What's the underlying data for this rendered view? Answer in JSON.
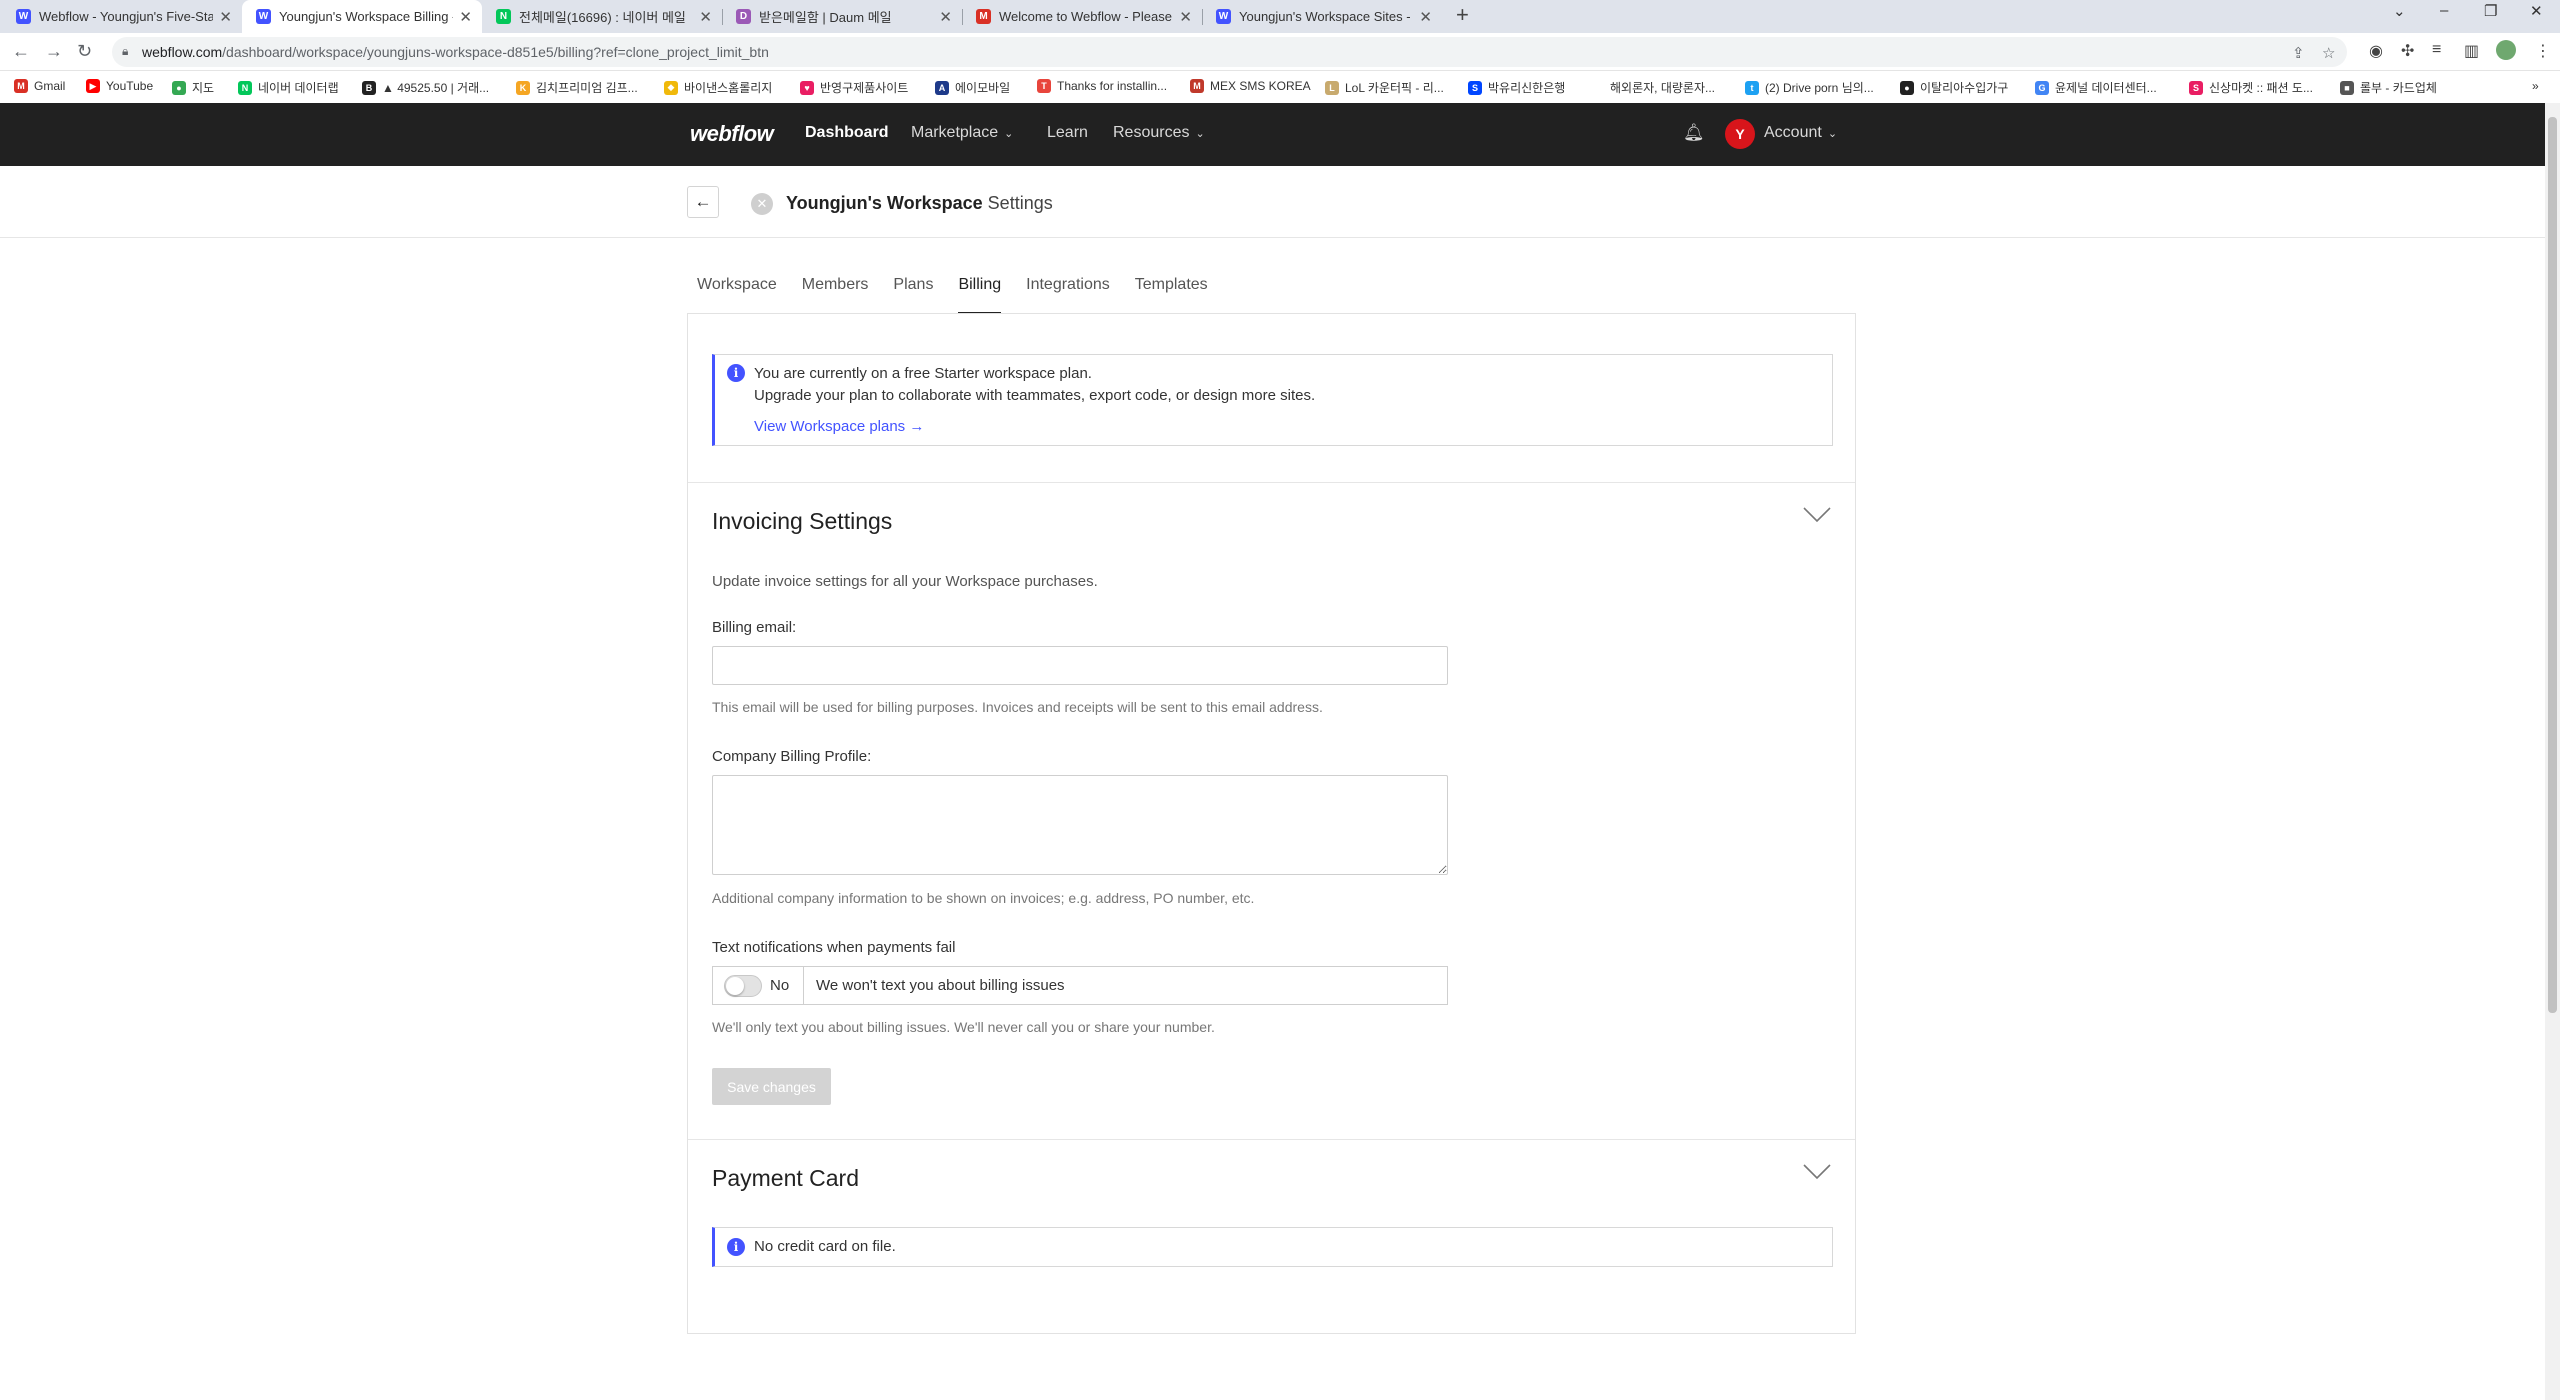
{
  "browser": {
    "tabs": [
      {
        "title": "Webflow - Youngjun's Five-Star",
        "icon": "webflow-icon",
        "color": "#4353ff",
        "glyph": "W",
        "active": false
      },
      {
        "title": "Youngjun's Workspace Billing - ",
        "icon": "webflow-icon",
        "color": "#4353ff",
        "glyph": "W",
        "active": true
      },
      {
        "title": "전체메일(16696) : 네이버 메일",
        "icon": "naver-mail-icon",
        "color": "#03c75a",
        "glyph": "N",
        "active": false
      },
      {
        "title": "받은메일함 | Daum 메일",
        "icon": "daum-mail-icon",
        "color": "#9b59b6",
        "glyph": "D",
        "active": false
      },
      {
        "title": "Welcome to Webflow - Please ",
        "icon": "gmail-icon",
        "color": "#d93025",
        "glyph": "M",
        "active": false
      },
      {
        "title": "Youngjun's Workspace Sites - W",
        "icon": "webflow-icon",
        "color": "#4353ff",
        "glyph": "W",
        "active": false
      }
    ],
    "url_host": "webflow.com",
    "url_path": "/dashboard/workspace/youngjuns-workspace-d851e5/billing?ref=clone_project_limit_btn",
    "bookmarks": [
      {
        "label": "Gmail",
        "color": "#d93025",
        "glyph": "M"
      },
      {
        "label": "YouTube",
        "color": "#ff0000",
        "glyph": "▶"
      },
      {
        "label": "지도",
        "color": "#34a853",
        "glyph": "●"
      },
      {
        "label": "네이버 데이터랩",
        "color": "#03c75a",
        "glyph": "N"
      },
      {
        "label": "▲ 49525.50 | 거래...",
        "color": "#222222",
        "glyph": "B"
      },
      {
        "label": "김치프리미엄 김프...",
        "color": "#f5a623",
        "glyph": "K"
      },
      {
        "label": "바이낸스홈롤리지",
        "color": "#f0b90b",
        "glyph": "◆"
      },
      {
        "label": "반영구제품사이트",
        "color": "#e91e63",
        "glyph": "♥"
      },
      {
        "label": "에이모바일",
        "color": "#1e3a8a",
        "glyph": "A"
      },
      {
        "label": "Thanks for installin...",
        "color": "#e8453c",
        "glyph": "T"
      },
      {
        "label": "MEX SMS KOREA",
        "color": "#c0392b",
        "glyph": "M"
      },
      {
        "label": "LoL 카운터픽 - 리...",
        "color": "#c8aa6e",
        "glyph": "L"
      },
      {
        "label": "박유리신한은행",
        "color": "#0046ff",
        "glyph": "S"
      },
      {
        "label": "해외론자, 대량론자...",
        "color": "#ffffff",
        "glyph": ""
      },
      {
        "label": "(2) Drive porn 님의...",
        "color": "#1da1f2",
        "glyph": "t"
      },
      {
        "label": "이탈리아수입가구",
        "color": "#222222",
        "glyph": "●"
      },
      {
        "label": "윤제널 데이터센터...",
        "color": "#4285f4",
        "glyph": "G"
      },
      {
        "label": "신상마켓 :: 패션 도...",
        "color": "#e91e63",
        "glyph": "S"
      },
      {
        "label": "롤부 - 카드업체",
        "color": "#555555",
        "glyph": "■"
      }
    ]
  },
  "nav": {
    "logo": "webflow",
    "dashboard": "Dashboard",
    "marketplace": "Marketplace",
    "learn": "Learn",
    "resources": "Resources",
    "avatar_letter": "Y",
    "account": "Account"
  },
  "header": {
    "workspace_name": "Youngjun's Workspace",
    "suffix": "Settings"
  },
  "tabs": [
    "Workspace",
    "Members",
    "Plans",
    "Billing",
    "Integrations",
    "Templates"
  ],
  "active_tab": "Billing",
  "plan_notice": {
    "line1": "You are currently on a free Starter workspace plan.",
    "line2": "Upgrade your plan to collaborate with teammates, export code, or design more sites.",
    "link": "View Workspace plans →"
  },
  "invoicing": {
    "title": "Invoicing Settings",
    "description": "Update invoice settings for all your Workspace purchases.",
    "billing_email_label": "Billing email:",
    "billing_email_value": "",
    "billing_email_hint": "This email will be used for billing purposes. Invoices and receipts will be sent to this email address.",
    "company_profile_label": "Company Billing Profile:",
    "company_profile_value": "",
    "company_profile_hint": "Additional company information to be shown on invoices; e.g. address, PO number, etc.",
    "sms_label": "Text notifications when payments fail",
    "sms_state": "No",
    "sms_description": "We won't text you about billing issues",
    "sms_hint": "We'll only text you about billing issues. We'll never call you or share your number.",
    "save_button": "Save changes"
  },
  "payment": {
    "title": "Payment Card",
    "notice": "No credit card on file."
  }
}
